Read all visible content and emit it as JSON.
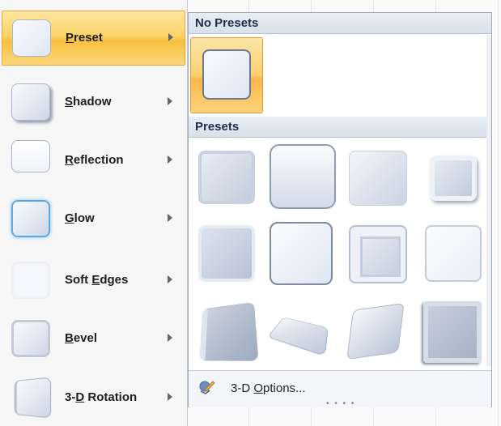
{
  "menu": {
    "items": [
      {
        "pre": "",
        "key": "P",
        "post": "reset",
        "active": true
      },
      {
        "pre": "",
        "key": "S",
        "post": "hadow",
        "active": false
      },
      {
        "pre": "",
        "key": "R",
        "post": "eflection",
        "active": false
      },
      {
        "pre": "",
        "key": "G",
        "post": "low",
        "active": false
      },
      {
        "pre": "Soft ",
        "key": "E",
        "post": "dges",
        "active": false
      },
      {
        "pre": "",
        "key": "B",
        "post": "evel",
        "active": false
      },
      {
        "pre": "3-",
        "key": "D",
        "post": " Rotation",
        "active": false
      }
    ]
  },
  "gallery": {
    "no_presets_header": "No Presets",
    "presets_header": "Presets",
    "preset_count": 12
  },
  "footer": {
    "options_pre": "3-D ",
    "options_key": "O",
    "options_post": "ptions..."
  },
  "colors": {
    "highlight": "#fbd36a",
    "tile_light": "#f7f9fd",
    "tile_dark": "#cdd6e6",
    "header_bg": "#dde4ee"
  }
}
